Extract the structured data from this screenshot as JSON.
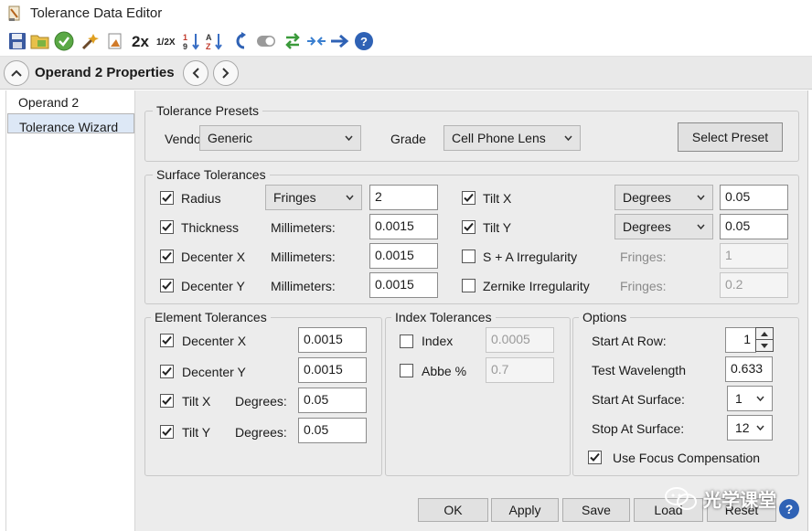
{
  "window": {
    "title": "Tolerance Data Editor"
  },
  "toolbar": {
    "zoom_2x": "2x",
    "zoom_half": "1/2X",
    "icons": [
      "save-icon",
      "open-icon",
      "check-icon",
      "wizard-icon",
      "clear-icon",
      "zoom-in-icon",
      "zoom-out-icon",
      "sort-ascending-icon",
      "sort-descending-icon",
      "undo-icon",
      "toggle-icon",
      "sync-icon",
      "collapse-icon",
      "next-arrow-icon",
      "help-icon"
    ]
  },
  "nav": {
    "title": "Operand  2 Properties"
  },
  "sidebar": {
    "items": [
      {
        "label": "Operand 2",
        "selected": false
      },
      {
        "label": "Tolerance Wizard",
        "selected": true
      }
    ]
  },
  "presets": {
    "title": "Tolerance Presets",
    "vendor_label": "Vendor",
    "vendor_value": "Generic",
    "grade_label": "Grade",
    "grade_value": "Cell Phone Lens",
    "select_button": "Select Preset"
  },
  "surface": {
    "title": "Surface Tolerances",
    "rows": [
      {
        "label": "Radius",
        "checked": true,
        "unit": "Fringes",
        "value": "2"
      },
      {
        "label": "Thickness",
        "checked": true,
        "unit": "Millimeters:",
        "value": "0.0015"
      },
      {
        "label": "Decenter X",
        "checked": true,
        "unit": "Millimeters:",
        "value": "0.0015"
      },
      {
        "label": "Decenter Y",
        "checked": true,
        "unit": "Millimeters:",
        "value": "0.0015"
      }
    ],
    "right_rows": [
      {
        "label": "Tilt X",
        "checked": true,
        "unit": "Degrees",
        "value": "0.05"
      },
      {
        "label": "Tilt Y",
        "checked": true,
        "unit": "Degrees",
        "value": "0.05"
      },
      {
        "label": "S + A Irregularity",
        "checked": false,
        "unit": "Fringes:",
        "value": "1"
      },
      {
        "label": "Zernike Irregularity",
        "checked": false,
        "unit": "Fringes:",
        "value": "0.2"
      }
    ]
  },
  "element": {
    "title": "Element Tolerances",
    "rows": [
      {
        "label": "Decenter X",
        "checked": true,
        "unit": "",
        "value": "0.0015"
      },
      {
        "label": "Decenter Y",
        "checked": true,
        "unit": "",
        "value": "0.0015"
      },
      {
        "label": "Tilt X",
        "checked": true,
        "unit": "Degrees:",
        "value": "0.05"
      },
      {
        "label": "Tilt Y",
        "checked": true,
        "unit": "Degrees:",
        "value": "0.05"
      }
    ]
  },
  "index": {
    "title": "Index Tolerances",
    "rows": [
      {
        "label": "Index",
        "checked": false,
        "value": "0.0005"
      },
      {
        "label": "Abbe %",
        "checked": false,
        "value": "0.7"
      }
    ]
  },
  "options": {
    "title": "Options",
    "start_row_label": "Start At Row:",
    "start_row_value": "1",
    "wavelength_label": "Test Wavelength",
    "wavelength_value": "0.633",
    "start_surface_label": "Start At Surface:",
    "start_surface_value": "1",
    "stop_surface_label": "Stop At Surface:",
    "stop_surface_value": "12",
    "focus_comp_label": "Use Focus Compensation",
    "focus_comp_checked": true
  },
  "footer": {
    "ok": "OK",
    "apply": "Apply",
    "save": "Save",
    "load": "Load",
    "reset": "Reset"
  },
  "watermark": {
    "text": "光学课堂"
  },
  "colors": {
    "selection": "#dde8f6",
    "panel": "#ececec",
    "help_blue": "#2f62b5"
  }
}
